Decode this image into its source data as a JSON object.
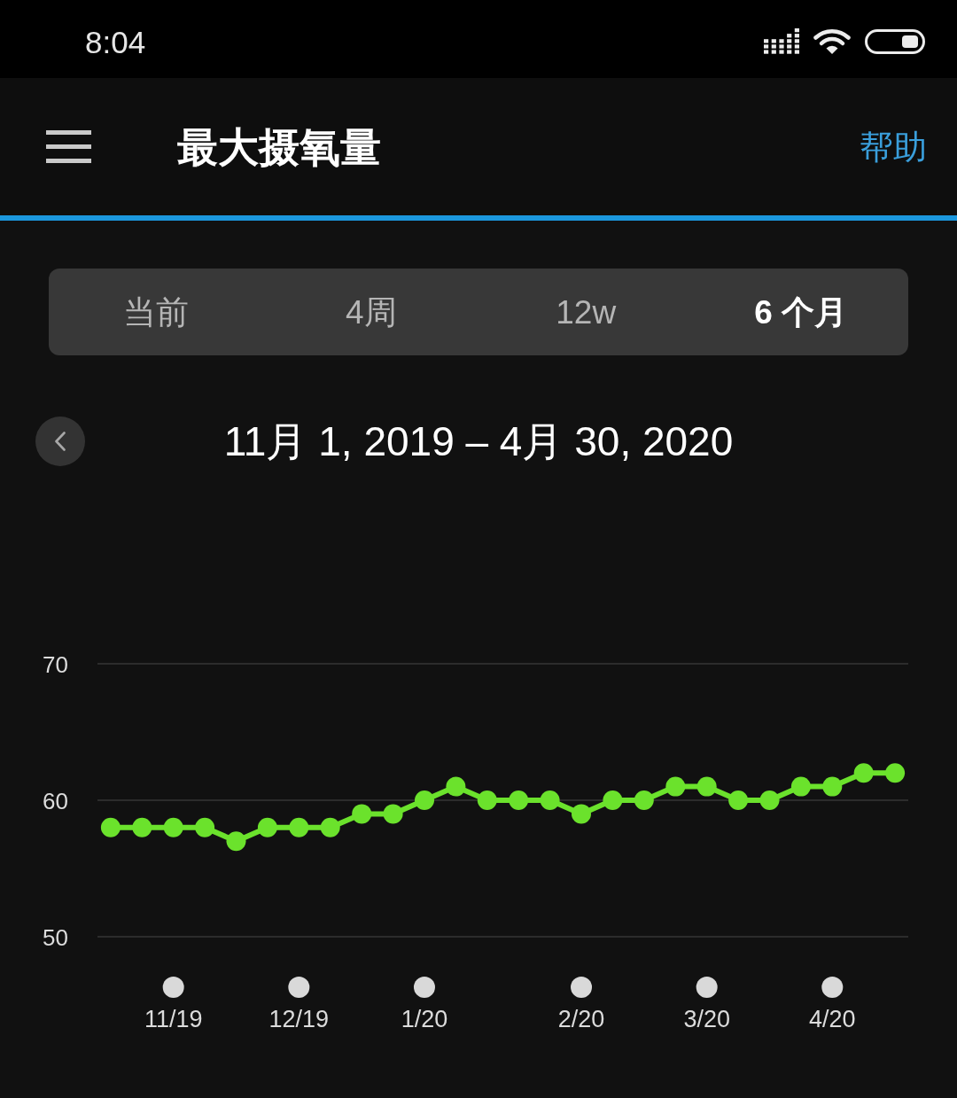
{
  "status_bar": {
    "time": "8:04"
  },
  "header": {
    "title": "最大摄氧量",
    "help_link": "帮助"
  },
  "tabs": [
    {
      "label": "当前",
      "selected": false
    },
    {
      "label": "4周",
      "selected": false
    },
    {
      "label": "12w",
      "selected": false
    },
    {
      "label": "6 个月",
      "selected": true
    }
  ],
  "date_range": {
    "label": "11月 1, 2019 – 4月 30, 2020"
  },
  "chart": {
    "chart_data": {
      "type": "line",
      "categories": [
        null,
        null,
        "11/19",
        null,
        null,
        null,
        "12/19",
        null,
        null,
        null,
        "1/20",
        null,
        null,
        null,
        null,
        "2/20",
        null,
        null,
        null,
        "3/20",
        null,
        null,
        null,
        "4/20",
        null,
        null
      ],
      "series": [
        {
          "color": "#6be22c",
          "marker": "circle",
          "values": [
            58,
            58,
            58,
            58,
            57,
            58,
            58,
            58,
            59,
            59,
            60,
            61,
            60,
            60,
            60,
            59,
            60,
            60,
            61,
            61,
            60,
            60,
            61,
            61,
            62,
            62
          ]
        }
      ],
      "ylim": [
        50,
        70
      ],
      "yticks": [
        50,
        60,
        70
      ]
    }
  }
}
